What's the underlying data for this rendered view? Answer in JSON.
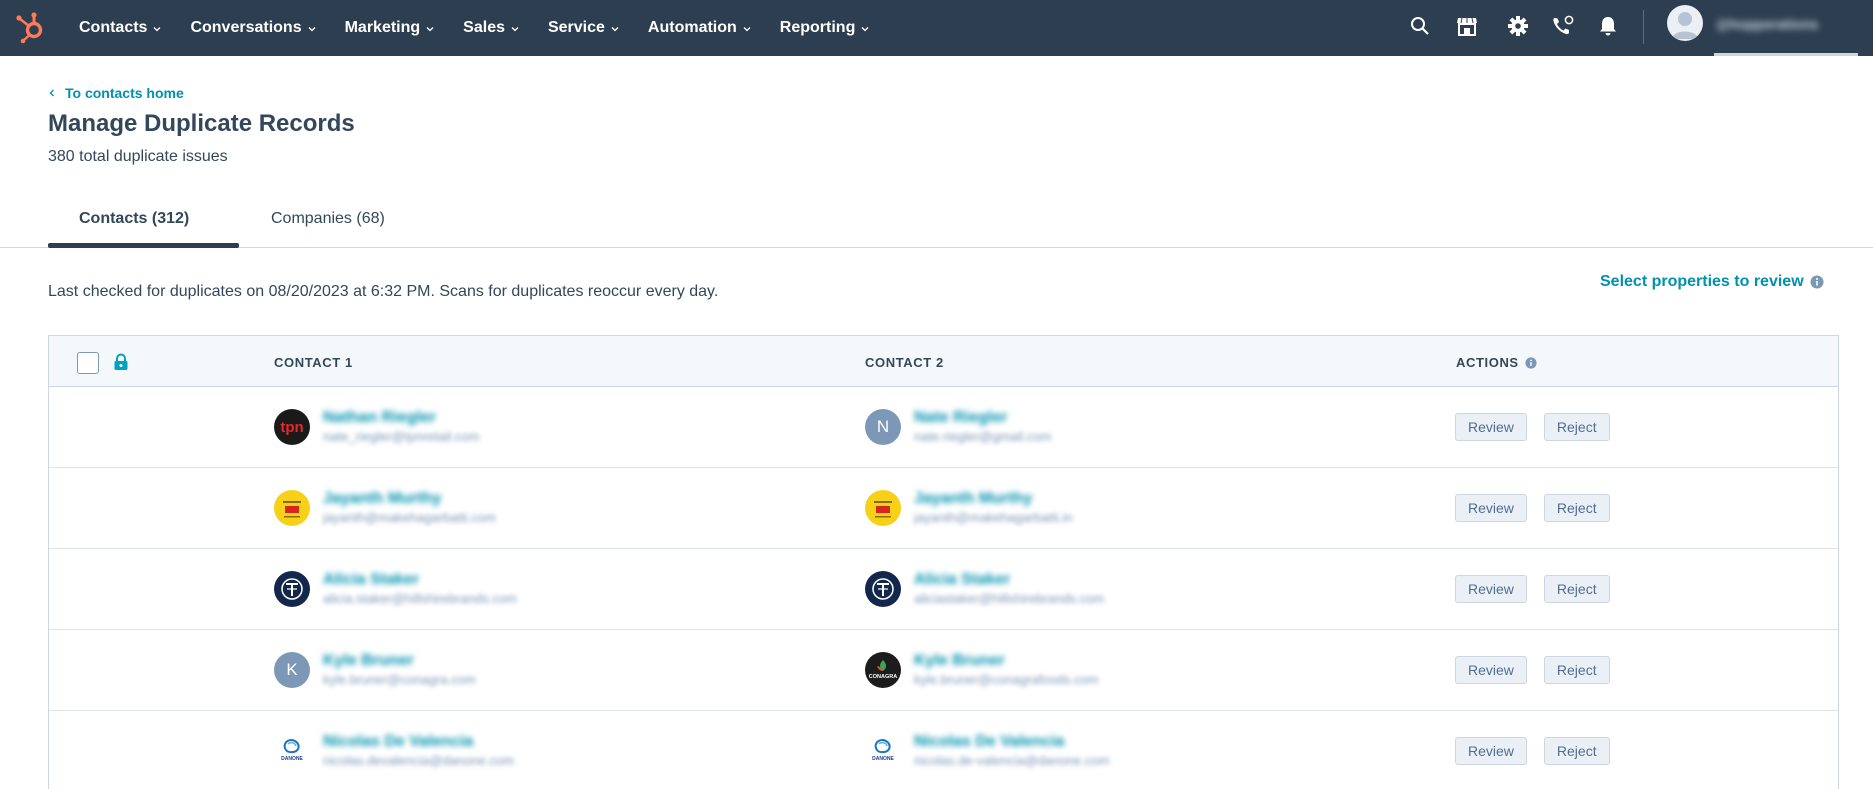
{
  "nav": {
    "items": [
      {
        "label": "Contacts"
      },
      {
        "label": "Conversations"
      },
      {
        "label": "Marketing"
      },
      {
        "label": "Sales"
      },
      {
        "label": "Service"
      },
      {
        "label": "Automation"
      },
      {
        "label": "Reporting"
      }
    ],
    "icons": [
      "search-icon",
      "marketplace-icon",
      "settings-icon",
      "calling-icon",
      "notifications-icon"
    ],
    "account_name": "@hopperations"
  },
  "header": {
    "back_link": "To contacts home",
    "title": "Manage Duplicate Records",
    "subtitle": "380 total duplicate issues"
  },
  "tabs": [
    {
      "label": "Contacts (312)",
      "active": true
    },
    {
      "label": "Companies (68)",
      "active": false
    }
  ],
  "info": {
    "last_checked": "Last checked for duplicates on 08/20/2023 at 6:32 PM. Scans for duplicates reoccur every day.",
    "select_properties": "Select properties to review"
  },
  "table": {
    "headers": {
      "contact1": "CONTACT 1",
      "contact2": "CONTACT 2",
      "actions": "ACTIONS"
    },
    "review_label": "Review",
    "reject_label": "Reject",
    "rows": [
      {
        "c1": {
          "name": "Nathan Riegler",
          "email": "nate_riegler@tpnretail.com",
          "avatar": "tpn-logo"
        },
        "c2": {
          "name": "Nate Riegler",
          "email": "nate.riegler@gmail.com",
          "avatar": "initial",
          "initial": "N"
        }
      },
      {
        "c1": {
          "name": "Jayanth Murthy",
          "email": "jayanth@makehagarbatti.com",
          "avatar": "yellow-logo"
        },
        "c2": {
          "name": "Jayanth Murthy",
          "email": "jayanth@makehagarbatti.in",
          "avatar": "yellow-logo"
        }
      },
      {
        "c1": {
          "name": "Alicia Staker",
          "email": "alicia.staker@hillshirebrands.com",
          "avatar": "t-logo"
        },
        "c2": {
          "name": "Alicia Staker",
          "email": "aliciastaker@hillshirebrands.com",
          "avatar": "t-logo"
        }
      },
      {
        "c1": {
          "name": "Kyle Bruner",
          "email": "kyle.bruner@conagra.com",
          "avatar": "initial",
          "initial": "K"
        },
        "c2": {
          "name": "Kyle Bruner",
          "email": "kyle.bruner@conagrafoods.com",
          "avatar": "conagra-logo",
          "logo_text": "CONAGRA"
        }
      },
      {
        "c1": {
          "name": "Nicolas De Valencia",
          "email": "nicolas.devalencia@danone.com",
          "avatar": "danone-logo",
          "logo_text": "DANONE"
        },
        "c2": {
          "name": "Nicolas De Valencia",
          "email": "nicolas.de-valencia@danone.com",
          "avatar": "danone-logo",
          "logo_text": "DANONE"
        }
      }
    ]
  },
  "colors": {
    "nav_bg": "#2d3e50",
    "accent": "#0091ae",
    "text": "#33475b",
    "hubspot_orange": "#ff7a59"
  }
}
